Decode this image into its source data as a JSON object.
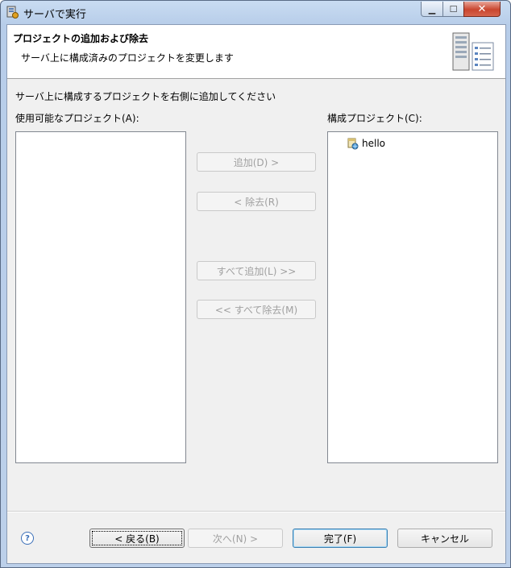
{
  "window": {
    "title": "サーバで実行",
    "close_glyph": "✕",
    "minimize_glyph": "▁",
    "maximize_glyph": "☐"
  },
  "banner": {
    "title": "プロジェクトの追加および除去",
    "subtitle": "サーバ上に構成済みのプロジェクトを変更します",
    "icon": "server-icon"
  },
  "main": {
    "instruction": "サーバ上に構成するプロジェクトを右側に追加してください",
    "available_label": "使用可能なプロジェクト(A):",
    "configured_label": "構成プロジェクト(C):",
    "available_items": [],
    "configured_items": [
      {
        "label": "hello",
        "icon": "web-project-icon"
      }
    ]
  },
  "actions": {
    "add": "追加(D) >",
    "remove": "< 除去(R)",
    "add_all": "すべて追加(L) >>",
    "remove_all": "<< すべて除去(M)"
  },
  "footer": {
    "help_glyph": "?",
    "back": "< 戻る(B)",
    "next": "次へ(N) >",
    "finish": "完了(F)",
    "cancel": "キャンセル"
  },
  "colors": {
    "accent": "#3c7fb1",
    "disabled_text": "#a0a0a0",
    "close_button": "#c9462f"
  }
}
